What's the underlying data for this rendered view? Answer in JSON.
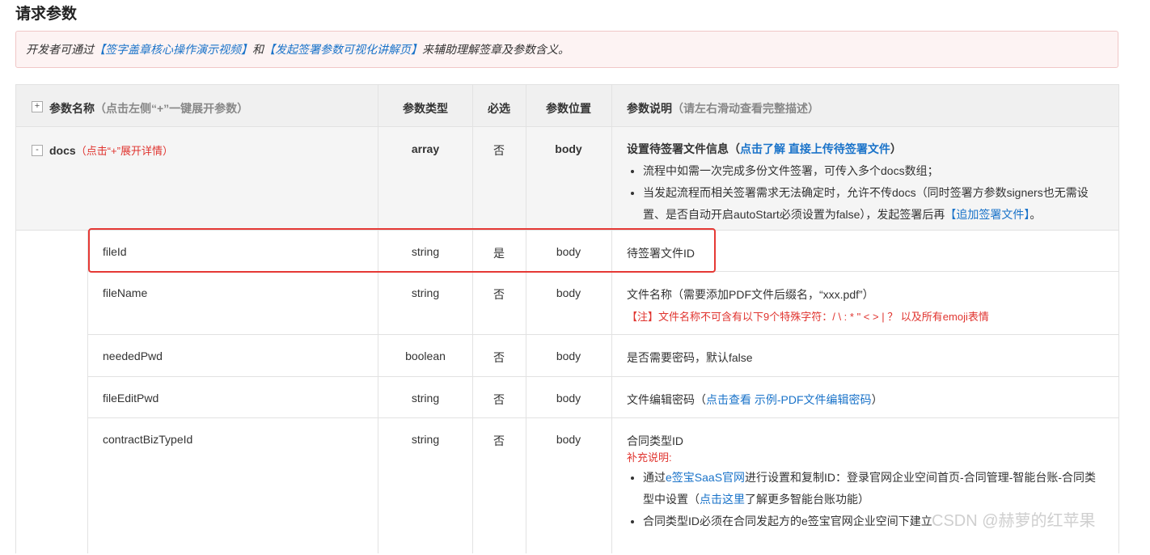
{
  "title": "请求参数",
  "notice": {
    "prefix": "开发者可通过",
    "link1": "【签字盖章核心操作演示视频】",
    "mid": "和",
    "link2": "【发起签署参数可视化讲解页】",
    "suffix": "来辅助理解签章及参数含义。"
  },
  "header": {
    "expand_icon": "+",
    "name": "参数名称",
    "name_hint": "（点击左侧“+”一键展开参数）",
    "type": "参数类型",
    "required": "必选",
    "position": "参数位置",
    "desc": "参数说明",
    "desc_hint": "（请左右滑动查看完整描述）"
  },
  "docs": {
    "collapse_icon": "-",
    "name": "docs",
    "hint": "（点击“+”展开详情）",
    "type": "array",
    "required": "否",
    "position": "body",
    "desc_title": "设置待签署文件信息（",
    "desc_link": "点击了解 直接上传待签署文件",
    "desc_title_end": "）",
    "bullet1": "流程中如需一次完成多份文件签署，可传入多个docs数组；",
    "bullet2_a": "当发起流程而相关签署需求无法确定时，允许不传docs（同时签署方参数signers也无需设置、是否自动开启autoStart必须设置为false），发起签署后再",
    "bullet2_link": "【追加签署文件】",
    "bullet2_end": "。"
  },
  "rows": [
    {
      "name": "fileId",
      "type": "string",
      "required": "是",
      "position": "body",
      "desc": "待签署文件ID"
    },
    {
      "name": "fileName",
      "type": "string",
      "required": "否",
      "position": "body",
      "desc": "文件名称（需要添加PDF文件后缀名，“xxx.pdf”）",
      "note": "【注】文件名称不可含有以下9个特殊字符：/ \\ : * \" < > | ？ 以及所有emoji表情"
    },
    {
      "name": "neededPwd",
      "type": "boolean",
      "required": "否",
      "position": "body",
      "desc": "是否需要密码，默认false"
    },
    {
      "name": "fileEditPwd",
      "type": "string",
      "required": "否",
      "position": "body",
      "desc": "文件编辑密码（",
      "desc_link": "点击查看 示例-PDF文件编辑密码",
      "desc_end": "）"
    },
    {
      "name": "contractBizTypeId",
      "type": "string",
      "required": "否",
      "position": "body",
      "desc": "合同类型ID",
      "supp": "补充说明:",
      "b1_a": "通过",
      "b1_link": "e签宝SaaS官网",
      "b1_b": "进行设置和复制ID：登录官网企业空间首页-合同管理-智能台账-合同类型中设置（",
      "b1_link2": "点击这里",
      "b1_c": "了解更多智能台账功能）",
      "b2": "合同类型ID必须在合同发起方的e签宝官网企业空间下建立"
    }
  ],
  "watermark": "CSDN @赫萝的红苹果",
  "colors": {
    "link": "#1a73c9",
    "warn": "#e0342f",
    "highlight_box": "#e53935",
    "notice_bg": "#fdf3f3"
  }
}
